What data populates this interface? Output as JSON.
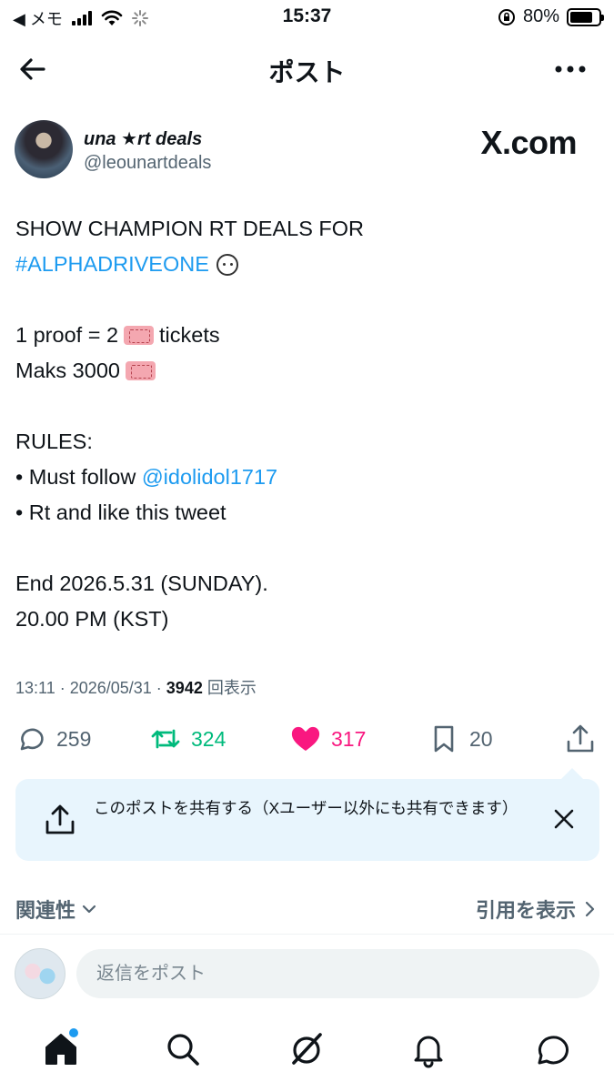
{
  "status_bar": {
    "back_app": "◀ メモ",
    "time": "15:37",
    "battery": "80%",
    "battery_level": 0.8
  },
  "header": {
    "title": "ポスト"
  },
  "author": {
    "display_name": "una ★rt deals",
    "handle": "@leounartdeals",
    "watermark": "X.com"
  },
  "post": {
    "line1": "SHOW CHAMPION RT DEALS FOR",
    "hashtag": "#ALPHADRIVEONE",
    "proof_prefix": "1 proof = 2",
    "proof_suffix": "tickets",
    "maks": "Maks 3000",
    "rules_heading": "RULES:",
    "rule1_prefix": "• Must follow ",
    "rule1_mention": "@idolidol1717",
    "rule2": "• Rt and like this tweet",
    "end_line": "End 2026.5.31 (SUNDAY).",
    "time_line": "20.00 PM (KST)"
  },
  "meta": {
    "timestamp": "13:11 · 2026/05/31 · ",
    "views_count": "3942",
    "views_label": " 回表示"
  },
  "actions": {
    "replies": "259",
    "reposts": "324",
    "likes": "317",
    "bookmarks": "20"
  },
  "share_banner": {
    "text": "このポストを共有する（Xユーザー以外にも共有できます）"
  },
  "related": {
    "relevance_label": "関連性",
    "quotes_label": "引用を表示"
  },
  "reply": {
    "placeholder": "返信をポスト"
  },
  "colors": {
    "accent": "#1d9bf0",
    "repost": "#00ba7c",
    "like": "#f91880",
    "muted": "#536471"
  }
}
